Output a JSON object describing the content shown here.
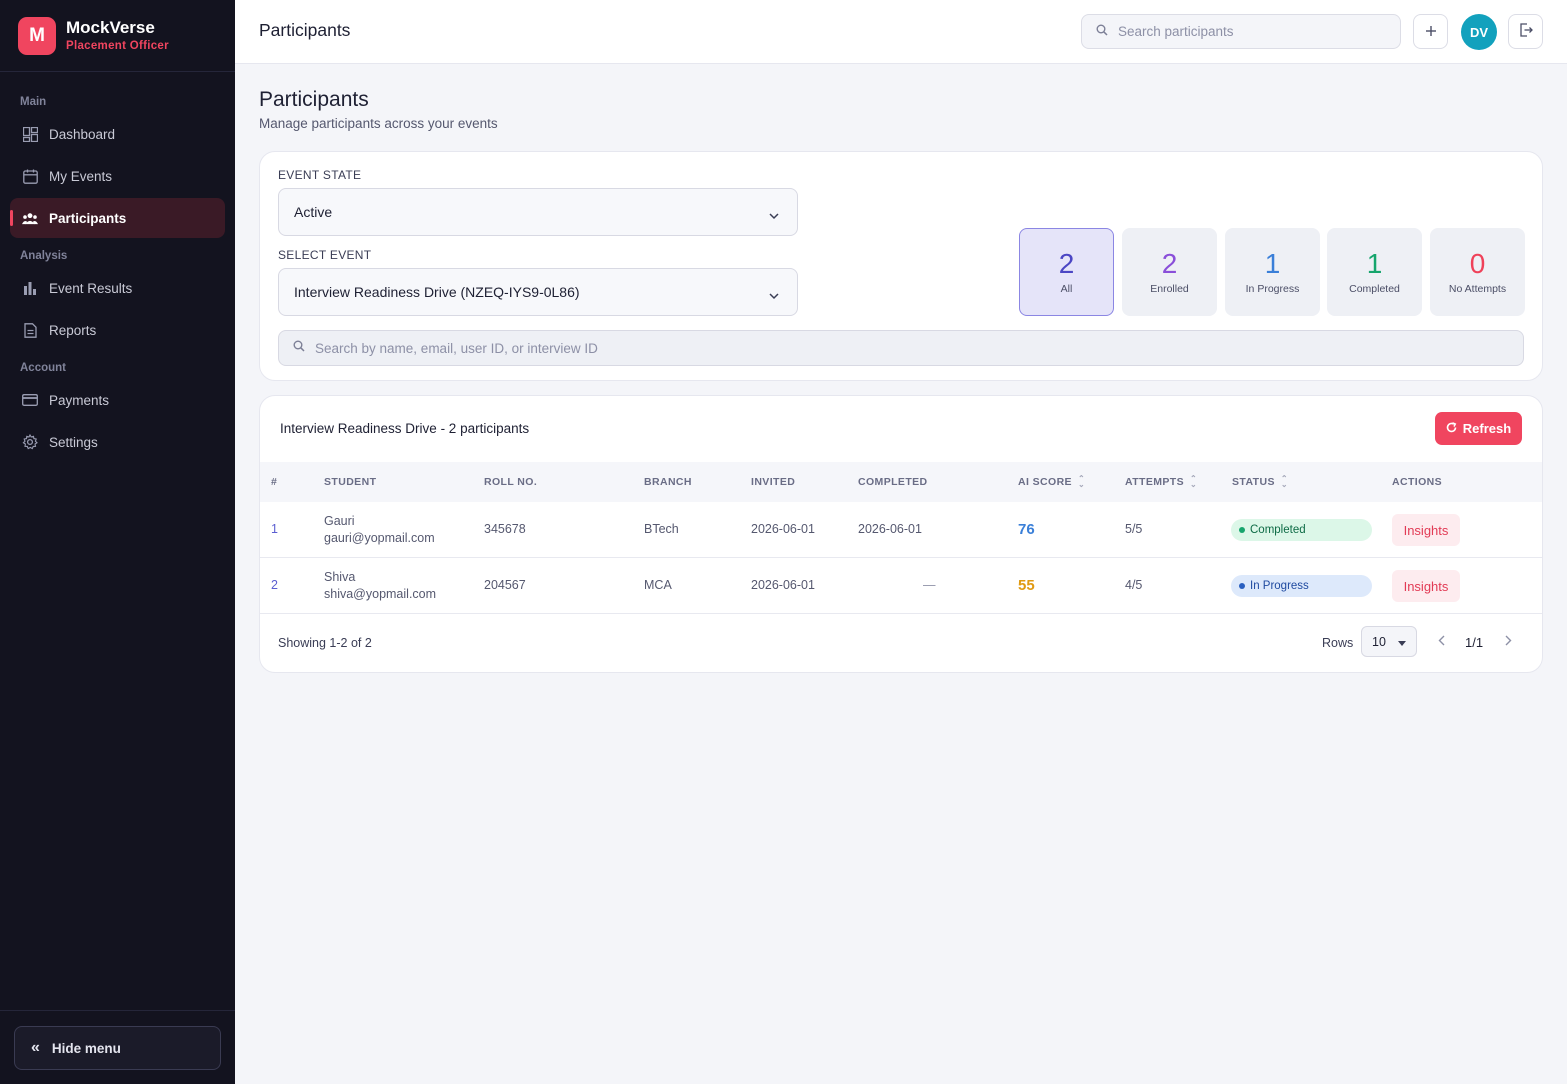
{
  "brand": {
    "logo_letter": "M",
    "name": "MockVerse",
    "role": "Placement Officer"
  },
  "sidebar": {
    "sections": [
      {
        "label": "Main"
      },
      {
        "label": "Analysis"
      },
      {
        "label": "Account"
      }
    ],
    "items": [
      {
        "label": "Dashboard",
        "icon": "dashboard-icon"
      },
      {
        "label": "My Events",
        "icon": "calendar-icon"
      },
      {
        "label": "Participants",
        "icon": "people-icon",
        "active": true
      },
      {
        "label": "Event Results",
        "icon": "bar-chart-icon"
      },
      {
        "label": "Reports",
        "icon": "document-icon"
      },
      {
        "label": "Payments",
        "icon": "credit-card-icon"
      },
      {
        "label": "Settings",
        "icon": "gear-icon"
      }
    ],
    "hide_menu_label": "Hide menu"
  },
  "topbar": {
    "title": "Participants",
    "search_placeholder": "Search participants",
    "avatar_initials": "DV"
  },
  "page": {
    "heading": "Participants",
    "subheading": "Manage participants across your events"
  },
  "filters": {
    "event_state_label": "EVENT STATE",
    "event_state_value": "Active",
    "select_event_label": "SELECT EVENT",
    "select_event_value": "Interview Readiness Drive (NZEQ-IYS9-0L86)",
    "search_placeholder": "Search by name, email, user ID, or interview ID"
  },
  "stats": [
    {
      "value": "2",
      "label": "All",
      "color": "#4b46c4",
      "active": true
    },
    {
      "value": "2",
      "label": "Enrolled",
      "color": "#8a4fd9"
    },
    {
      "value": "1",
      "label": "In Progress",
      "color": "#3a7fd8"
    },
    {
      "value": "1",
      "label": "Completed",
      "color": "#16a56d"
    },
    {
      "value": "0",
      "label": "No Attempts",
      "color": "#ef4159"
    }
  ],
  "table": {
    "title": "Interview Readiness Drive - 2 participants",
    "refresh_label": "Refresh",
    "columns": [
      "#",
      "STUDENT",
      "ROLL NO.",
      "BRANCH",
      "INVITED",
      "COMPLETED",
      "AI SCORE",
      "ATTEMPTS",
      "STATUS",
      "ACTIONS"
    ],
    "rows": [
      {
        "index": "1",
        "name": "Gauri",
        "email": "gauri@yopmail.com",
        "roll": "345678",
        "branch": "BTech",
        "invited": "2026-06-01",
        "completed": "2026-06-01",
        "score": "76",
        "score_color": "#3a7fd8",
        "attempts": "5/5",
        "status": "Completed",
        "status_bg": "#dcf7e8",
        "status_dot": "#16a56d",
        "status_text": "#0d6b45",
        "action": "Insights"
      },
      {
        "index": "2",
        "name": "Shiva",
        "email": "shiva@yopmail.com",
        "roll": "204567",
        "branch": "MCA",
        "invited": "2026-06-01",
        "completed": "—",
        "score": "55",
        "score_color": "#e09a12",
        "attempts": "4/5",
        "status": "In Progress",
        "status_bg": "#dde9fb",
        "status_dot": "#2a5fc0",
        "status_text": "#1f4aa0",
        "action": "Insights"
      }
    ],
    "showing": "Showing 1-2 of 2",
    "rows_label": "Rows",
    "rows_value": "10",
    "page": "1/1"
  }
}
